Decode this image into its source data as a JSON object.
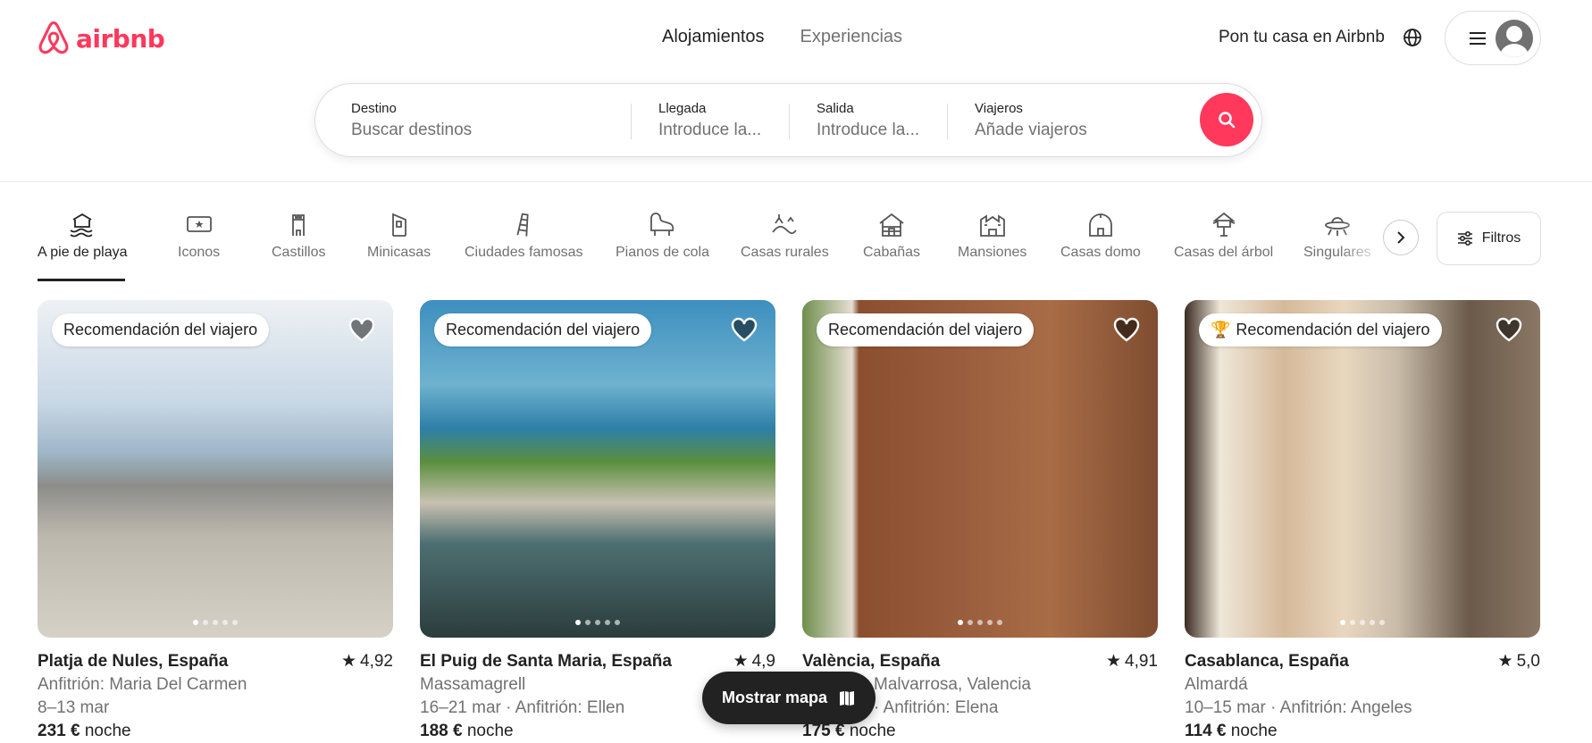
{
  "header": {
    "brand": "airbnb",
    "tabs": [
      "Alojamientos",
      "Experiencias"
    ],
    "host_link": "Pon tu casa en Airbnb",
    "brand_color": "#ff385c"
  },
  "search": {
    "destination": {
      "label": "Destino",
      "placeholder": "Buscar destinos"
    },
    "checkin": {
      "label": "Llegada",
      "placeholder": "Introduce la..."
    },
    "checkout": {
      "label": "Salida",
      "placeholder": "Introduce la..."
    },
    "guests": {
      "label": "Viajeros",
      "placeholder": "Añade viajeros"
    },
    "button_icon": "search-icon"
  },
  "categories": [
    {
      "label": "A pie de playa",
      "icon": "beach-icon",
      "active": true
    },
    {
      "label": "Iconos",
      "icon": "ticket-icon"
    },
    {
      "label": "Castillos",
      "icon": "castle-icon"
    },
    {
      "label": "Minicasas",
      "icon": "tiny-house-icon"
    },
    {
      "label": "Ciudades famosas",
      "icon": "tower-icon"
    },
    {
      "label": "Pianos de cola",
      "icon": "piano-icon"
    },
    {
      "label": "Casas rurales",
      "icon": "countryside-icon"
    },
    {
      "label": "Cabañas",
      "icon": "cabin-icon"
    },
    {
      "label": "Mansiones",
      "icon": "mansion-icon"
    },
    {
      "label": "Casas domo",
      "icon": "dome-icon"
    },
    {
      "label": "Casas del árbol",
      "icon": "treehouse-icon"
    },
    {
      "label": "Singulares",
      "icon": "ufo-icon"
    }
  ],
  "filters_label": "Filtros",
  "listings": [
    {
      "badge": "Recomendación del viajero",
      "title": "Platja de Nules, España",
      "rating": "4,92",
      "line2": "Anfitrión: Maria Del Carmen",
      "line3": "8–13 mar",
      "price": "231 €",
      "price_unit": "noche"
    },
    {
      "badge": "Recomendación del viajero",
      "title": "El Puig de Santa Maria, España",
      "rating": "4,9",
      "line2": "Massamagrell",
      "line3": "16–21 mar · Anfitrión: Ellen",
      "price": "188 €",
      "price_unit": "noche"
    },
    {
      "badge": "Recomendación del viajero",
      "title": "València, España",
      "rating": "4,91",
      "line2": "Malvarrosa, Valencia",
      "line3": "· Anfitrión: Elena",
      "price": "175 €",
      "price_unit": "noche"
    },
    {
      "badge": "Recomendación del viajero",
      "title": "Casablanca, España",
      "rating": "5,0",
      "line2": "Almardá",
      "line3": "10–15 mar · Anfitrión: Angeles",
      "price": "114 €",
      "price_unit": "noche"
    }
  ],
  "map_button": "Mostrar mapa"
}
